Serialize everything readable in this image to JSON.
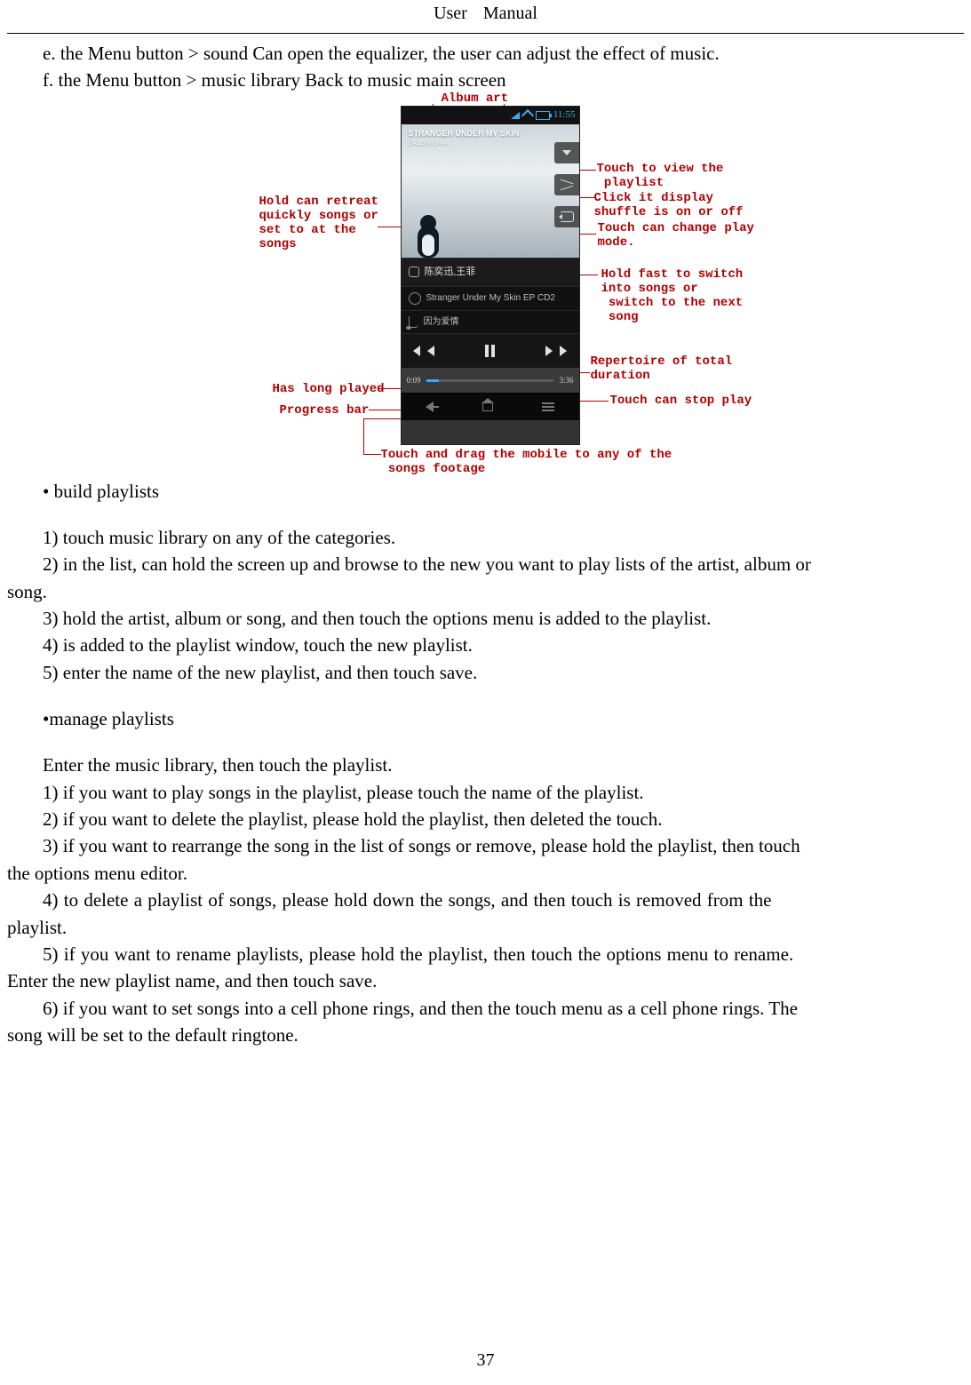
{
  "header": {
    "left": "User",
    "right": "Manual"
  },
  "page_number": "37",
  "lines": {
    "e": "e. the Menu button > sound Can open the equalizer, the user can adjust the effect of music.",
    "f": "f. the Menu button > music library Back to music main screen",
    "build": "• build playlists",
    "b1": "1) touch music library on any of the categories.",
    "b2a": "2) in the list, can hold the screen up and browse to the new you want to play lists of the artist, album or",
    "b2b": "song.",
    "b3": "3) hold the artist, album or song, and then touch the options menu is added to the playlist.",
    "b4": "4) is added to the playlist window, touch the new playlist.",
    "b5": "5) enter the name of the new playlist, and then touch save.",
    "manage": " •manage playlists",
    "m0": "Enter the music library, then touch the playlist.",
    "m1": "1) if you want to play songs in the playlist, please touch the name of the playlist.",
    "m2": "2) if you want to delete the playlist, please hold the playlist, then deleted the touch.",
    "m3a": "3) if you want to rearrange the song in the list of songs or remove, please hold the playlist, then touch",
    "m3b": "the options menu editor.",
    "m4a": "4)  to  delete  a  playlist  of  songs,  please  hold  down  the  songs,  and  then  touch  is  removed  from  the",
    "m4b": "playlist.",
    "m5a": "5)  if  you  want  to  rename  playlists,  please  hold  the  playlist,  then  touch  the  options  menu  to  rename.",
    "m5b": "Enter the new playlist name, and then touch save.",
    "m6a": "6) if you want to set songs into a cell phone rings, and then the touch menu as a cell phone rings. The",
    "m6b": "song will be set to the default ringtone."
  },
  "callouts": {
    "album_art": "Album art",
    "hold_retreat": "Hold can retreat\nquickly songs or\nset to at the\nsongs",
    "has_long": "Has long played",
    "progress": "Progress bar",
    "view_playlist": "Touch to view the\n playlist",
    "shuffle": "Click it display\nshuffle is on or off",
    "change_mode": "Touch can change play\nmode.",
    "hold_next": "Hold fast to switch\ninto songs or\n switch to the next\n song",
    "duration": "Repertoire of total\nduration",
    "stop_play": "Touch can stop play",
    "drag": "Touch and drag the mobile to any of the\n songs footage"
  },
  "phone": {
    "clock": "11:55",
    "album_title": "STRANGER UNDER MY SKIN",
    "album_sub": "EASON CHAN",
    "artist_row": "陈奕迅,王菲",
    "track1": "Stranger Under My Skin EP CD2",
    "track2": "因为爱情",
    "time_elapsed": "0:09",
    "time_total": "3:36"
  }
}
